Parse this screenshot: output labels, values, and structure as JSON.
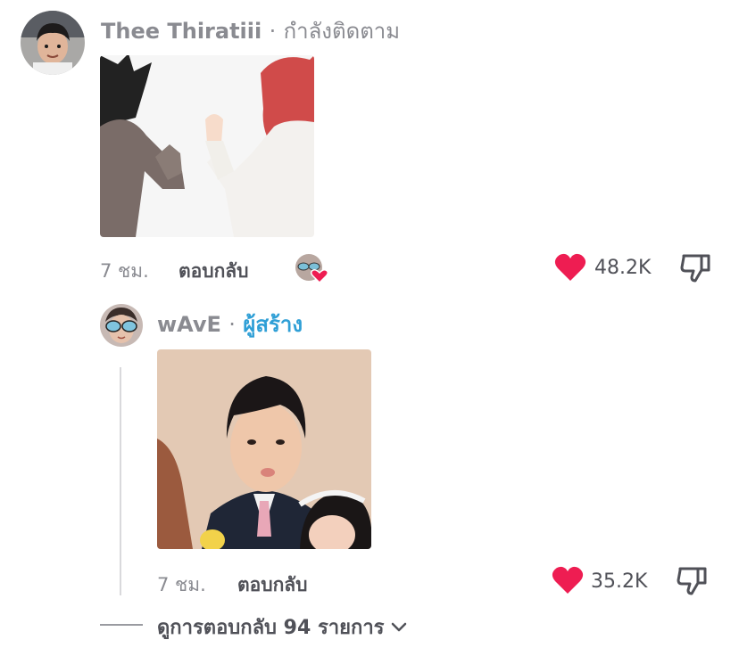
{
  "comment": {
    "author": "Thee Thiratiii",
    "separator": "·",
    "relation": "กำลังติดตาม",
    "avatar_icon": "person-avatar",
    "image_icon": "anime-sticker-image",
    "time": "7 ชม.",
    "reply_label": "ตอบกลับ",
    "creator_liked_icon": "creator-liked-heart-icon",
    "likes": "48.2K",
    "like_icon": "heart-icon",
    "dislike_icon": "thumbs-down-icon"
  },
  "reply": {
    "author": "wAvE",
    "separator": "·",
    "badge": "ผู้สร้าง",
    "avatar_icon": "creator-avatar",
    "image_icon": "photo-image",
    "time": "7 ชม.",
    "reply_label": "ตอบกลับ",
    "likes": "35.2K",
    "like_icon": "heart-icon",
    "dislike_icon": "thumbs-down-icon"
  },
  "view_replies": {
    "label": "ดูการตอบกลับ 94 รายการ",
    "icon": "chevron-down-icon"
  },
  "colors": {
    "like": "#ee1d52",
    "creator_badge": "#2f9fd6",
    "muted_text": "#8a8b91"
  }
}
